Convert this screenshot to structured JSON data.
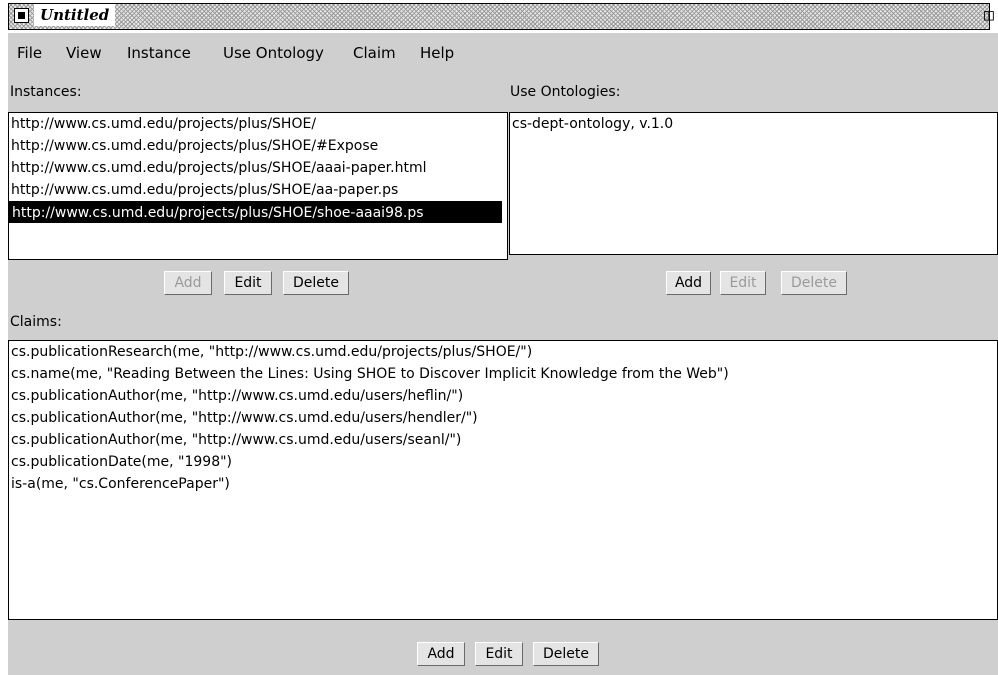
{
  "window": {
    "title": "Untitled"
  },
  "menu": [
    "File",
    "View",
    "Instance",
    "Use Ontology",
    "Claim",
    "Help"
  ],
  "instances": {
    "label": "Instances:",
    "items": [
      "http://www.cs.umd.edu/projects/plus/SHOE/",
      "http://www.cs.umd.edu/projects/plus/SHOE/#Expose",
      "http://www.cs.umd.edu/projects/plus/SHOE/aaai-paper.html",
      "http://www.cs.umd.edu/projects/plus/SHOE/aa-paper.ps",
      "http://www.cs.umd.edu/projects/plus/SHOE/shoe-aaai98.ps"
    ],
    "selected_index": 4,
    "buttons": {
      "add": "Add",
      "edit": "Edit",
      "delete": "Delete"
    }
  },
  "ontologies": {
    "label": "Use Ontologies:",
    "items": [
      "cs-dept-ontology, v.1.0"
    ],
    "buttons": {
      "add": "Add",
      "edit": "Edit",
      "delete": "Delete"
    }
  },
  "claims": {
    "label": "Claims:",
    "items": [
      "cs.publicationResearch(me, \"http://www.cs.umd.edu/projects/plus/SHOE/\")",
      "cs.name(me, \"Reading Between the Lines: Using SHOE to Discover Implicit Knowledge from the Web\")",
      "cs.publicationAuthor(me, \"http://www.cs.umd.edu/users/heflin/\")",
      "cs.publicationAuthor(me, \"http://www.cs.umd.edu/users/hendler/\")",
      "cs.publicationAuthor(me, \"http://www.cs.umd.edu/users/seanl/\")",
      "cs.publicationDate(me, \"1998\")",
      "is-a(me, \"cs.ConferencePaper\")"
    ],
    "buttons": {
      "add": "Add",
      "edit": "Edit",
      "delete": "Delete"
    }
  }
}
